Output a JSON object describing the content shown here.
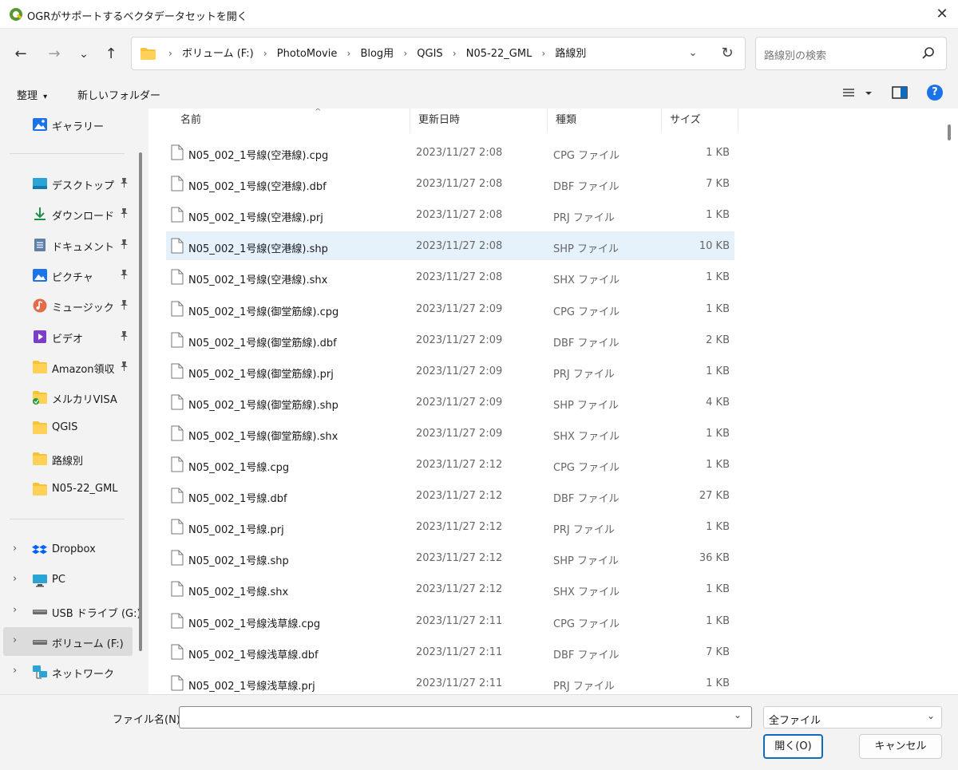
{
  "window": {
    "title": "OGRがサポートするベクタデータセットを開く",
    "close_glyph": "✕"
  },
  "nav": {
    "back": "←",
    "forward": "→",
    "recent": "⌄",
    "up": "↑",
    "breadcrumb": [
      "ボリューム (F:)",
      "PhotoMovie",
      "Blog用",
      "QGIS",
      "N05-22_GML",
      "路線別"
    ],
    "separator": "›",
    "dropdown": "⌄",
    "refresh": "↻",
    "search_placeholder": "路線別の検索"
  },
  "toolbar": {
    "organize": "整理",
    "organize_arrow": "▾",
    "new_folder": "新しいフォルダー",
    "help": "?"
  },
  "sidebar": {
    "top": [
      {
        "label": "ギャラリー",
        "icon": "gallery-icon"
      }
    ],
    "pinned": [
      {
        "label": "デスクトップ",
        "icon": "desktop-icon",
        "pinned": true
      },
      {
        "label": "ダウンロード",
        "icon": "download-icon",
        "pinned": true
      },
      {
        "label": "ドキュメント",
        "icon": "document-icon",
        "pinned": true
      },
      {
        "label": "ピクチャ",
        "icon": "pictures-icon",
        "pinned": true
      },
      {
        "label": "ミュージック",
        "icon": "music-icon",
        "pinned": true
      },
      {
        "label": "ビデオ",
        "icon": "video-icon",
        "pinned": true
      },
      {
        "label": "Amazon領収",
        "icon": "folder-icon",
        "pinned": true
      },
      {
        "label": "メルカリVISA",
        "icon": "folder-sync-icon",
        "pinned": false
      },
      {
        "label": "QGIS",
        "icon": "folder-icon",
        "pinned": false
      },
      {
        "label": "路線別",
        "icon": "folder-icon",
        "pinned": false
      },
      {
        "label": "N05-22_GML",
        "icon": "folder-icon",
        "pinned": false
      }
    ],
    "locations": [
      {
        "label": "Dropbox",
        "icon": "dropbox-icon",
        "selected": false
      },
      {
        "label": "PC",
        "icon": "pc-icon",
        "selected": false
      },
      {
        "label": "USB ドライブ (G:)",
        "icon": "drive-icon",
        "selected": false
      },
      {
        "label": "ボリューム (F:)",
        "icon": "drive-icon",
        "selected": true
      },
      {
        "label": "ネットワーク",
        "icon": "network-icon",
        "selected": false
      }
    ],
    "pin_glyph": "📌",
    "chevron": "›"
  },
  "columns": {
    "name": "名前",
    "date": "更新日時",
    "type": "種類",
    "size": "サイズ",
    "sort_arrow": "^"
  },
  "files": [
    {
      "name": "N05_002_1号線(空港線).cpg",
      "date": "2023/11/27 2:08",
      "type": "CPG ファイル",
      "size": "1 KB",
      "selected": false
    },
    {
      "name": "N05_002_1号線(空港線).dbf",
      "date": "2023/11/27 2:08",
      "type": "DBF ファイル",
      "size": "7 KB",
      "selected": false
    },
    {
      "name": "N05_002_1号線(空港線).prj",
      "date": "2023/11/27 2:08",
      "type": "PRJ ファイル",
      "size": "1 KB",
      "selected": false
    },
    {
      "name": "N05_002_1号線(空港線).shp",
      "date": "2023/11/27 2:08",
      "type": "SHP ファイル",
      "size": "10 KB",
      "selected": true
    },
    {
      "name": "N05_002_1号線(空港線).shx",
      "date": "2023/11/27 2:08",
      "type": "SHX ファイル",
      "size": "1 KB",
      "selected": false
    },
    {
      "name": "N05_002_1号線(御堂筋線).cpg",
      "date": "2023/11/27 2:09",
      "type": "CPG ファイル",
      "size": "1 KB",
      "selected": false
    },
    {
      "name": "N05_002_1号線(御堂筋線).dbf",
      "date": "2023/11/27 2:09",
      "type": "DBF ファイル",
      "size": "2 KB",
      "selected": false
    },
    {
      "name": "N05_002_1号線(御堂筋線).prj",
      "date": "2023/11/27 2:09",
      "type": "PRJ ファイル",
      "size": "1 KB",
      "selected": false
    },
    {
      "name": "N05_002_1号線(御堂筋線).shp",
      "date": "2023/11/27 2:09",
      "type": "SHP ファイル",
      "size": "4 KB",
      "selected": false
    },
    {
      "name": "N05_002_1号線(御堂筋線).shx",
      "date": "2023/11/27 2:09",
      "type": "SHX ファイル",
      "size": "1 KB",
      "selected": false
    },
    {
      "name": "N05_002_1号線.cpg",
      "date": "2023/11/27 2:12",
      "type": "CPG ファイル",
      "size": "1 KB",
      "selected": false
    },
    {
      "name": "N05_002_1号線.dbf",
      "date": "2023/11/27 2:12",
      "type": "DBF ファイル",
      "size": "27 KB",
      "selected": false
    },
    {
      "name": "N05_002_1号線.prj",
      "date": "2023/11/27 2:12",
      "type": "PRJ ファイル",
      "size": "1 KB",
      "selected": false
    },
    {
      "name": "N05_002_1号線.shp",
      "date": "2023/11/27 2:12",
      "type": "SHP ファイル",
      "size": "36 KB",
      "selected": false
    },
    {
      "name": "N05_002_1号線.shx",
      "date": "2023/11/27 2:12",
      "type": "SHX ファイル",
      "size": "1 KB",
      "selected": false
    },
    {
      "name": "N05_002_1号線浅草線.cpg",
      "date": "2023/11/27 2:11",
      "type": "CPG ファイル",
      "size": "1 KB",
      "selected": false
    },
    {
      "name": "N05_002_1号線浅草線.dbf",
      "date": "2023/11/27 2:11",
      "type": "DBF ファイル",
      "size": "7 KB",
      "selected": false
    },
    {
      "name": "N05_002_1号線浅草線.prj",
      "date": "2023/11/27 2:11",
      "type": "PRJ ファイル",
      "size": "1 KB",
      "selected": false
    }
  ],
  "footer": {
    "filename_label": "ファイル名(N):",
    "filename_value": "",
    "filetype": "全ファイル",
    "dropdown": "⌄",
    "open_button": "開く(O)",
    "cancel_button": "キャンセル"
  },
  "colors": {
    "accent": "#0f6cbd",
    "selection": "#e5f1fb",
    "folder": "#f5c23a",
    "qgis_green": "#589632"
  }
}
